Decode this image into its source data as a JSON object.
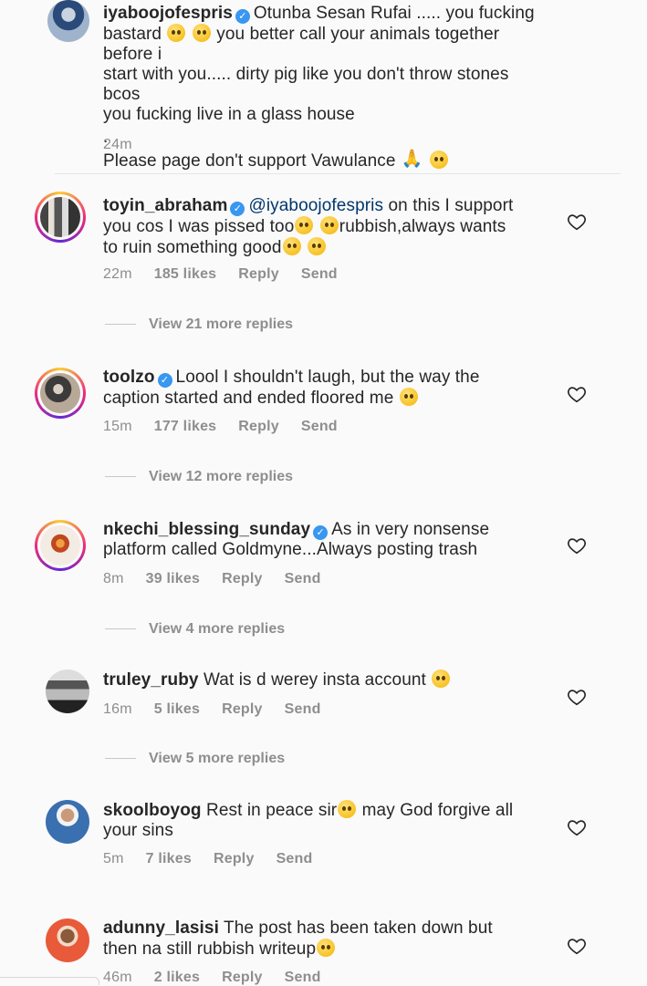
{
  "caption": {
    "username": "iyaboojofespris",
    "line1": "Otunba Sesan Rufai ..... you fucking",
    "line2a": "bastard",
    "line2b": "you better call your animals together before i",
    "line3": "start with you..... dirty pig like you don't throw stones bcos",
    "line4": "you fucking live in a glass house",
    "dot": ".",
    "line5": "Please page don't support Vawulance",
    "time": "24m"
  },
  "comments": [
    {
      "username": "toyin_abraham",
      "mention": "@iyaboojofespris",
      "l1": "on this I support",
      "l2a": "you cos I was pissed too",
      "l2b": "rubbish,always wants",
      "l3": "to ruin something good",
      "time": "22m",
      "likes": "185 likes",
      "reply": "Reply",
      "send": "Send",
      "view_replies": "View 21 more replies"
    },
    {
      "username": "toolzo",
      "l1": "Loool I shouldn't laugh, but the way the",
      "l2": "caption started and ended floored me",
      "time": "15m",
      "likes": "177 likes",
      "reply": "Reply",
      "send": "Send",
      "view_replies": "View 12 more replies"
    },
    {
      "username": "nkechi_blessing_sunday",
      "l1": "As in very nonsense",
      "l2": "platform called Goldmyne...Always posting trash",
      "time": "8m",
      "likes": "39 likes",
      "reply": "Reply",
      "send": "Send",
      "view_replies": "View 4 more replies"
    },
    {
      "username": "truley_ruby",
      "l1": "Wat is d werey insta account",
      "time": "16m",
      "likes": "5 likes",
      "reply": "Reply",
      "send": "Send",
      "view_replies": "View 5 more replies"
    },
    {
      "username": "skoolboyog",
      "l1a": "Rest in peace sir",
      "l1b": "may God forgive all",
      "l2": "your sins",
      "time": "5m",
      "likes": "7 likes",
      "reply": "Reply",
      "send": "Send"
    },
    {
      "username": "adunny_lasisi",
      "l1": "The post has been taken down but",
      "l2": "then na still rubbish writeup",
      "time": "46m",
      "likes": "2 likes",
      "reply": "Reply",
      "send": "Send"
    }
  ],
  "icons": {
    "verified": "verified-badge-icon",
    "like": "heart-icon"
  },
  "colors": {
    "verified": "#3897f0",
    "meta": "#8e8e8e",
    "mention": "#00376b"
  }
}
